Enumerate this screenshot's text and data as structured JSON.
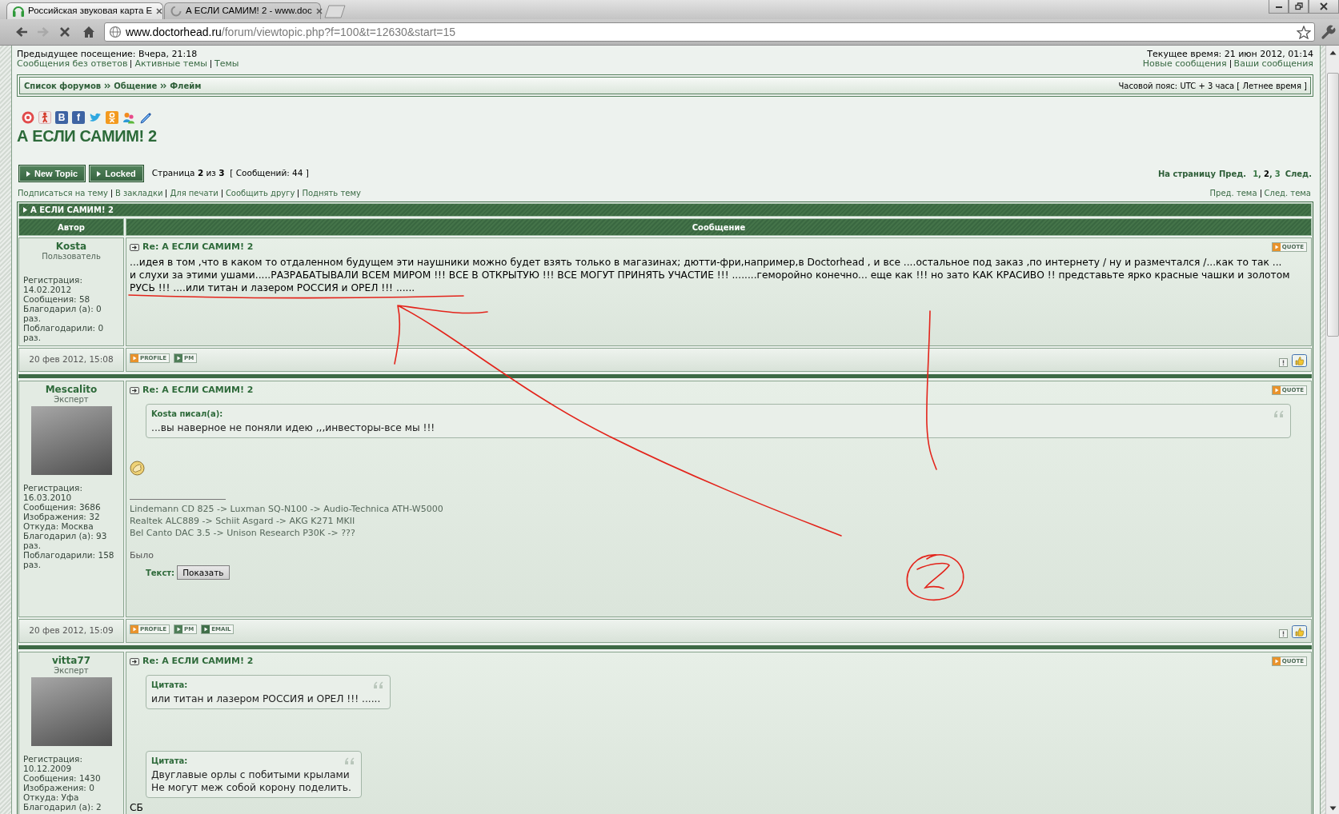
{
  "browser": {
    "tabs": [
      {
        "title": "Российская звуковая карта Е",
        "selected": false,
        "kind": "headphones"
      },
      {
        "title": "А ЕСЛИ САМИМ! 2 - www.doc",
        "selected": true,
        "kind": "loading"
      }
    ],
    "nav": [
      {
        "kind": "back",
        "disabled": false
      },
      {
        "kind": "forward",
        "disabled": true
      },
      {
        "kind": "stop",
        "disabled": false
      },
      {
        "kind": "home",
        "disabled": false
      }
    ],
    "address": {
      "host": "www.doctorhead.ru",
      "path": "/forum/viewtopic.php?f=100&t=12630&start=15"
    }
  },
  "header": {
    "last_visit": "Предыдущее посещение: Вчера, 21:18",
    "links": [
      "Сообщения без ответов",
      "Активные темы",
      "Темы"
    ],
    "current_time": "Текущее время: 21 июн 2012, 01:14",
    "user_links": [
      "Новые сообщения",
      "Ваши сообщения"
    ]
  },
  "breadcrumbs": [
    "Список форумов",
    "Общение",
    "Флейм"
  ],
  "timezone": "Часовой пояс: UTC + 3 часа [ Летнее время ]",
  "share_icons": [
    {
      "kind": "badge"
    },
    {
      "kind": "figure"
    },
    {
      "kind": "letter",
      "glyph": "B"
    },
    {
      "kind": "letter",
      "glyph": "f"
    },
    {
      "kind": "bird"
    },
    {
      "kind": "figure_tile"
    },
    {
      "kind": "people"
    },
    {
      "kind": "pencil"
    }
  ],
  "topic_title": "А ЕСЛИ САМИМ! 2",
  "topic_buttons": [
    "New Topic",
    "Locked"
  ],
  "page_info": "Страница **2** из **3**  [ Сообщений: 44 ]",
  "pagination": {
    "label": "На страницу",
    "prev": "Пред.",
    "pages": [
      {
        "label": "1",
        "selected": false
      },
      {
        "label": "2",
        "selected": true
      },
      {
        "label": "3",
        "selected": false
      }
    ],
    "separator": ",",
    "next": "След."
  },
  "topic_links": [
    "Подписаться на тему",
    "В закладки",
    "Для печати",
    "Сообщить другу",
    "Поднять тему"
  ],
  "topic_nav": [
    "Пред. тема",
    "След. тема"
  ],
  "topic_bar": "А ЕСЛИ САМИМ! 2",
  "columns": [
    "Автор",
    "Сообщение"
  ],
  "posts": [
    {
      "author": "Kosta",
      "rank": "Пользователь",
      "avatar": false,
      "stats": [
        "Регистрация: 14.02.2012",
        "Сообщения: 58",
        "Благодарил (а): 0 раз.",
        "Поблагодарили: 0 раз."
      ],
      "subject": "Re: А ЕСЛИ САМИМ! 2",
      "quote_button": "QUOTE",
      "body": [
        {
          "kind": "text",
          "lines": [
            "...идея в том ,что в каком то отдаленном будущем эти наушники можно будет взять только в магазинах; дютти-фри,например,в Doctorhead , и все ....остальное под заказ ,по интернету / ну и размечтался /...как то так ...",
            "и слухи за этими ушами.....РАЗРАБАТЫВАЛИ ВСЕМ МИРОМ !!! ВСЕ В ОТКРЫТУЮ !!! ВСЕ МОГУТ ПРИНЯТЬ УЧАСТИЕ !!! ........геморойно конечно... еще как !!! но зато КАК КРАСИВО !! представьте ярко красные чашки и золотом",
            "РУСЬ !!! ....или титан и лазером РОССИЯ и ОРЕЛ !!! ......"
          ]
        }
      ],
      "date": "20 фев 2012, 15:08",
      "actions": [
        {
          "label": "PROFILE",
          "color": "#e8922c"
        },
        {
          "label": "PM",
          "color": "#4e7d57"
        }
      ]
    },
    {
      "author": "Mescalito",
      "rank": "Эксперт",
      "avatar": true,
      "stats": [
        "Регистрация: 16.03.2010",
        "Сообщения: 3686",
        "Изображения: 32",
        "Откуда: Москва",
        "Благодарил (а): 93 раз.",
        "Поблагодарили: 158 раз."
      ],
      "subject": "Re: А ЕСЛИ САМИМ! 2",
      "quote_button": "QUOTE",
      "body": [
        {
          "kind": "quote",
          "title": "Kosta писал(а):",
          "lines": [
            "...вы наверное не поняли идею ,,,инвесторы-все мы !!!"
          ],
          "full_width": true
        },
        {
          "kind": "break"
        },
        {
          "kind": "emoji"
        },
        {
          "kind": "signature",
          "lines": [
            "Lindemann CD 825 -> Luxman SQ-N100 -> Audio-Technica ATH-W5000",
            "Realtek ALC889 -> Schiit Asgard -> AKG K271 MKII",
            "Bel Canto DAC 3.5 -> Unison Research P30K -> ???"
          ],
          "note": "Было",
          "spoiler_label": "Текст:",
          "spoiler_button": "Показать"
        }
      ],
      "date": "20 фев 2012, 15:09",
      "actions": [
        {
          "label": "PROFILE",
          "color": "#e8922c"
        },
        {
          "label": "PM",
          "color": "#4e7d57"
        },
        {
          "label": "EMAIL",
          "color": "#3f6e48"
        }
      ]
    },
    {
      "author": "vitta77",
      "rank": "Эксперт",
      "avatar": true,
      "stats": [
        "Регистрация: 10.12.2009",
        "Сообщения: 1430",
        "Изображения: 0",
        "Откуда: Уфа",
        "Благодарил (а): 2"
      ],
      "subject": "Re: А ЕСЛИ САМИМ! 2",
      "quote_button": "QUOTE",
      "body": [
        {
          "kind": "quote",
          "title": "Цитата:",
          "lines": [
            "или титан и лазером РОССИЯ и ОРЕЛ !!! ......"
          ],
          "full_width": false
        },
        {
          "kind": "break"
        },
        {
          "kind": "break"
        },
        {
          "kind": "break"
        },
        {
          "kind": "quote",
          "title": "Цитата:",
          "lines": [
            "Двуглавые орлы с побитыми крылами",
            "Не могут меж собой корону поделить."
          ],
          "full_width": false
        },
        {
          "kind": "text",
          "lines": [
            "СБ"
          ]
        }
      ]
    }
  ],
  "annotations": [
    {
      "kind": "underline"
    },
    {
      "kind": "arrow"
    },
    {
      "kind": "stroke"
    },
    {
      "kind": "circle"
    }
  ]
}
